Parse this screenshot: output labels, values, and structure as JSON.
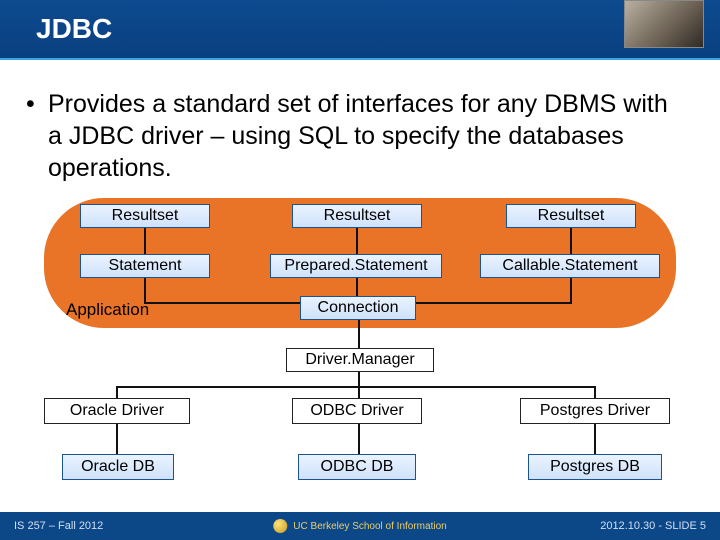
{
  "title": "JDBC",
  "bullet": "Provides a standard set of interfaces for any DBMS with a JDBC driver – using SQL to specify the databases operations.",
  "diagram": {
    "resultsets": [
      "Resultset",
      "Resultset",
      "Resultset"
    ],
    "statements": [
      "Statement",
      "Prepared.Statement",
      "Callable.Statement"
    ],
    "application_label": "Application",
    "connection": "Connection",
    "driver_manager": "Driver.Manager",
    "drivers": [
      "Oracle Driver",
      "ODBC Driver",
      "Postgres Driver"
    ],
    "databases": [
      "Oracle DB",
      "ODBC DB",
      "Postgres DB"
    ]
  },
  "footer": {
    "left": "IS 257 – Fall 2012",
    "affiliation": "UC Berkeley School of Information",
    "right": "2012.10.30 - SLIDE 5"
  }
}
